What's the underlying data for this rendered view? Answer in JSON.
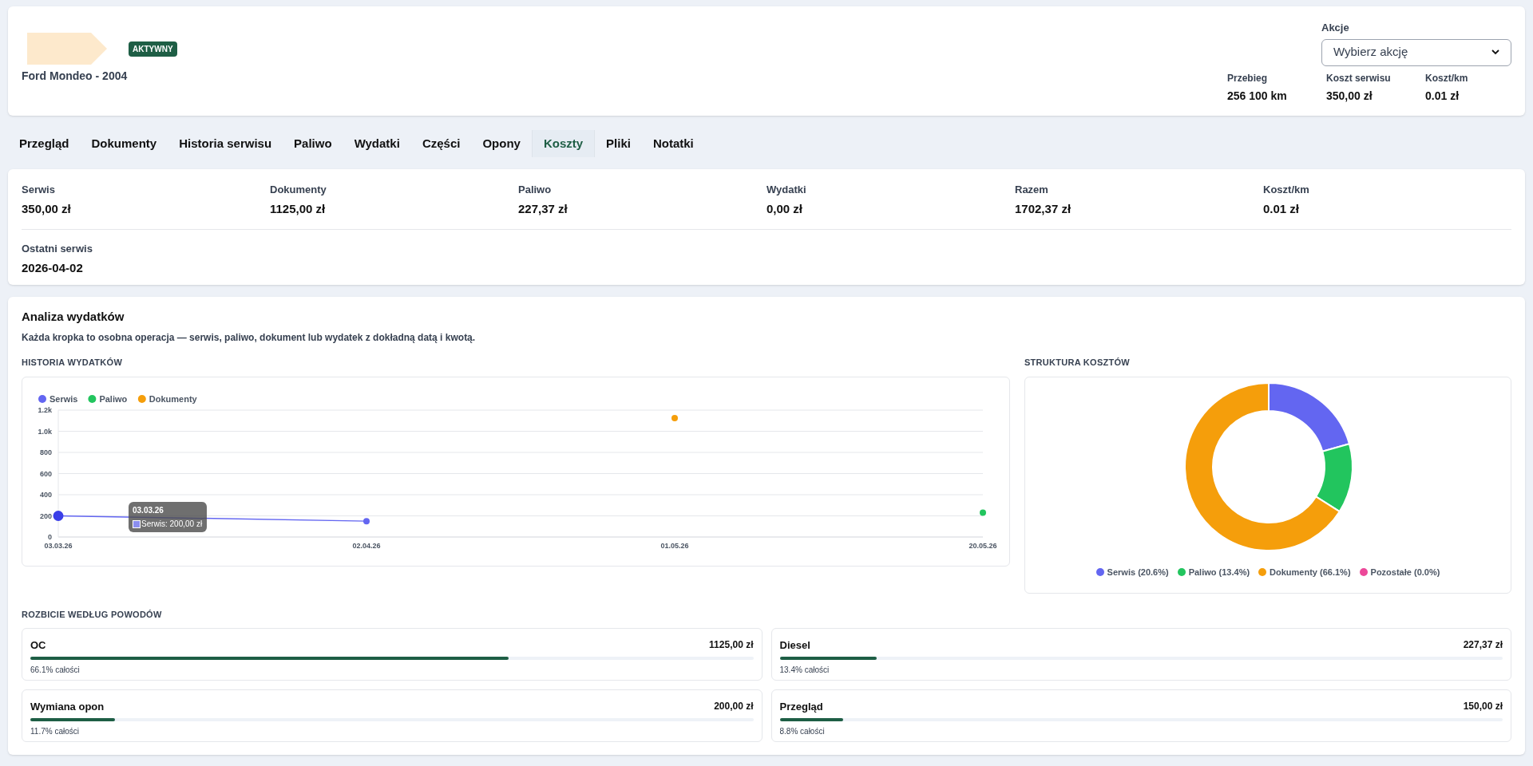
{
  "header": {
    "status": "AKTYWNY",
    "subtitle": "Ford Mondeo - 2004",
    "actions": {
      "label": "Akcje",
      "placeholder": "Wybierz akcję"
    },
    "stats": [
      {
        "label": "Przebieg",
        "value": "256 100 km"
      },
      {
        "label": "Koszt serwisu",
        "value": "350,00 zł"
      },
      {
        "label": "Koszt/km",
        "value": "0.01 zł"
      }
    ]
  },
  "tabs": [
    {
      "label": "Przegląd",
      "selected": false
    },
    {
      "label": "Dokumenty",
      "selected": false
    },
    {
      "label": "Historia serwisu",
      "selected": false
    },
    {
      "label": "Paliwo",
      "selected": false
    },
    {
      "label": "Wydatki",
      "selected": false
    },
    {
      "label": "Części",
      "selected": false
    },
    {
      "label": "Opony",
      "selected": false
    },
    {
      "label": "Koszty",
      "selected": true
    },
    {
      "label": "Pliki",
      "selected": false
    },
    {
      "label": "Notatki",
      "selected": false
    }
  ],
  "summary": [
    {
      "label": "Serwis",
      "value": "350,00 zł"
    },
    {
      "label": "Dokumenty",
      "value": "1125,00 zł"
    },
    {
      "label": "Paliwo",
      "value": "227,37 zł"
    },
    {
      "label": "Wydatki",
      "value": "0,00 zł"
    },
    {
      "label": "Razem",
      "value": "1702,37 zł"
    },
    {
      "label": "Koszt/km",
      "value": "0.01 zł"
    }
  ],
  "last_service": {
    "label": "Ostatni serwis",
    "value": "2026-04-02"
  },
  "analysis": {
    "title": "Analiza wydatków",
    "subtitle": "Każda kropka to osobna operacja — serwis, paliwo, dokument lub wydatek z dokładną datą i kwotą.",
    "history": {
      "heading": "HISTORIA WYDATKÓW",
      "tooltip": {
        "title": "03.03.26",
        "text": "Serwis: 200,00 zł"
      },
      "chart_data": {
        "type": "line",
        "grid": true,
        "legend": true,
        "categories": [
          "03.03.26",
          "02.04.26",
          "01.05.26",
          "20.05.26"
        ],
        "ylim": [
          0,
          1200
        ],
        "yticks": [
          0,
          200,
          400,
          600,
          800,
          {
            "value": 1000,
            "label": "1.0k"
          },
          {
            "value": 1200,
            "label": "1.2k"
          }
        ],
        "series": [
          {
            "name": "Serwis",
            "color": "#6366f1",
            "marker": true,
            "values": [
              200,
              150,
              null,
              null
            ]
          },
          {
            "name": "Paliwo",
            "color": "#22c55e",
            "marker": true,
            "values": [
              null,
              null,
              null,
              230
            ]
          },
          {
            "name": "Dokumenty",
            "color": "#f59e0b",
            "marker": true,
            "values": [
              null,
              null,
              1125,
              null
            ]
          }
        ]
      }
    },
    "structure": {
      "heading": "STRUKTURA KOSZTÓW",
      "chart_data": {
        "type": "donut",
        "legend": true,
        "categories": [
          "Serwis (20.6%)",
          "Paliwo (13.4%)",
          "Dokumenty (66.1%)",
          "Pozostałe (0.0%)"
        ],
        "series": [
          {
            "values": [
              20.6,
              13.4,
              66.1,
              0.0
            ]
          }
        ],
        "colors": [
          "#6366f1",
          "#22c55e",
          "#f59e0b",
          "#ec4899"
        ]
      }
    },
    "breakdown": {
      "heading": "ROZBICIE WEDŁUG POWODÓW",
      "items": [
        {
          "name": "OC",
          "amount": "1125,00 zł",
          "level": 0.661,
          "share": "66.1% całości"
        },
        {
          "name": "Diesel",
          "amount": "227,37 zł",
          "level": 0.134,
          "share": "13.4% całości"
        },
        {
          "name": "Wymiana opon",
          "amount": "200,00 zł",
          "level": 0.117,
          "share": "11.7% całości"
        },
        {
          "name": "Przegląd",
          "amount": "150,00 zł",
          "level": 0.088,
          "share": "8.8% całości"
        }
      ]
    }
  }
}
